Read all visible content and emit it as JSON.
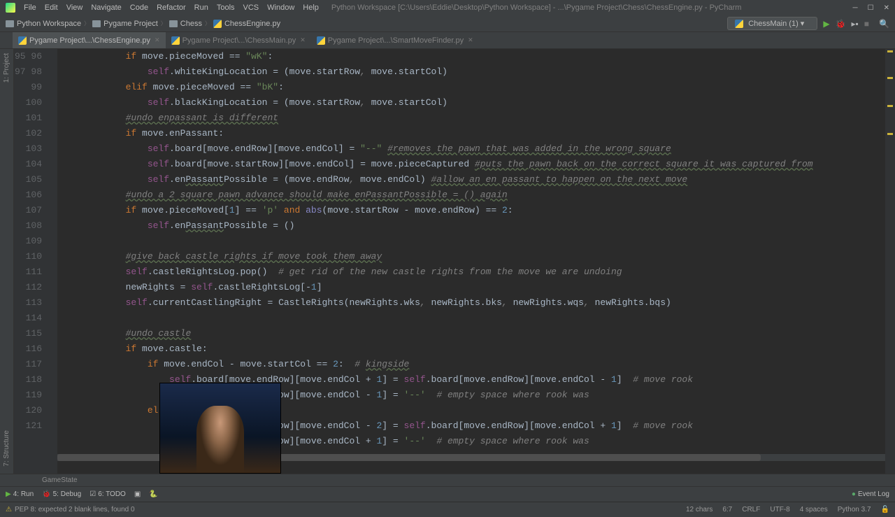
{
  "titlebar": {
    "menus": [
      "File",
      "Edit",
      "View",
      "Navigate",
      "Code",
      "Refactor",
      "Run",
      "Tools",
      "VCS",
      "Window",
      "Help"
    ],
    "title": "Python Workspace [C:\\Users\\Eddie\\Desktop\\Python Workspace] - ...\\Pygame Project\\Chess\\ChessEngine.py - PyCharm"
  },
  "breadcrumbs": [
    "Python Workspace",
    "Pygame Project",
    "Chess",
    "ChessEngine.py"
  ],
  "run_config": "ChessMain (1)",
  "tabs": [
    {
      "label": "Pygame Project\\...\\ChessEngine.py",
      "active": true
    },
    {
      "label": "Pygame Project\\...\\ChessMain.py",
      "active": false
    },
    {
      "label": "Pygame Project\\...\\SmartMoveFinder.py",
      "active": false
    }
  ],
  "gutter_labels": [
    "1: Project",
    "7: Structure"
  ],
  "line_start": 95,
  "line_end": 121,
  "code_breadcrumb": "GameState",
  "bottom_tools": {
    "run": "4: Run",
    "debug": "5: Debug",
    "todo": "6: TODO",
    "terminal": "",
    "console": "",
    "eventlog": "Event Log"
  },
  "status": {
    "msg": "PEP 8: expected 2 blank lines, found 0",
    "chars": "12 chars",
    "pos": "6:7",
    "le": "CRLF",
    "enc": "UTF-8",
    "indent": "4 spaces",
    "py": "Python 3.7"
  },
  "colors": {
    "kw": "#cc7832",
    "str": "#6a8759",
    "self": "#94558d",
    "num": "#6897bb",
    "cmt": "#808080"
  }
}
